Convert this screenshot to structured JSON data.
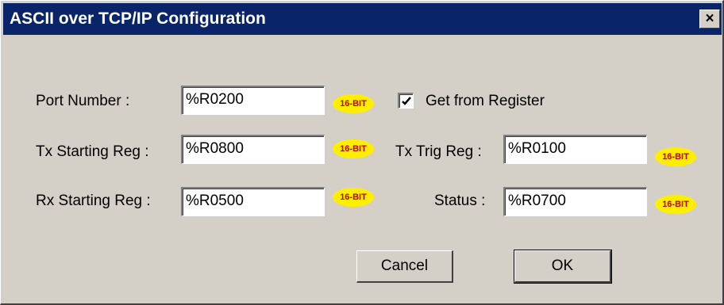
{
  "window": {
    "title": "ASCII over TCP/IP Configuration",
    "close_label": "×"
  },
  "fields": {
    "port_number": {
      "label": "Port Number :",
      "value": "%R0200",
      "badge": "16-BIT"
    },
    "tx_starting_reg": {
      "label": "Tx Starting Reg :",
      "value": "%R0800",
      "badge": "16-BIT"
    },
    "rx_starting_reg": {
      "label": "Rx Starting Reg :",
      "value": "%R0500",
      "badge": "16-BIT"
    },
    "tx_trig_reg": {
      "label": "Tx Trig Reg :",
      "value": "%R0100",
      "badge": "16-BIT"
    },
    "status": {
      "label": "Status :",
      "value": "%R0700",
      "badge": "16-BIT"
    }
  },
  "get_from_register": {
    "label": "Get from Register",
    "checked": true
  },
  "buttons": {
    "cancel": "Cancel",
    "ok": "OK"
  },
  "colors": {
    "titlebar": "#0a246a",
    "dialog_face": "#d4d0c8",
    "badge_fill": "#ffee00",
    "badge_text": "#c00000"
  }
}
